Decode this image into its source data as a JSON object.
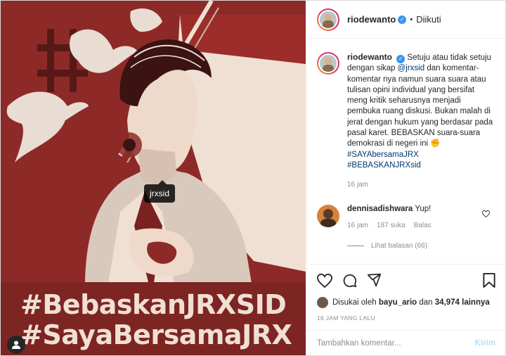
{
  "post": {
    "image_tag": "jrxsid",
    "poster_lines": [
      "#BebaskanJRXSID",
      "#SayaBersamaJRX"
    ]
  },
  "header": {
    "username": "riodewanto",
    "verified_mark": "✓",
    "separator": "•",
    "follow_state": "Diikuti"
  },
  "caption": {
    "username": "riodewanto",
    "text_1": "Setuju atau tidak setuju dengan sikap",
    "mention": "@jrxsid",
    "text_2": "dan komentar-komentar nya namun suara suara atau tulisan opini individual yang bersifat meng kritik seharusnya menjadi pembuka ruang diskusi. Bukan malah di jerat dengan hukum yang berdasar pada pasal karet. BEBASKAN suara-suara demokrasi di negeri ini",
    "emoji": "✊",
    "hashtag_1": "#SAYAbersamaJRX",
    "hashtag_2": "#BEBASKANJRXsid",
    "time": "16 jam"
  },
  "comment": {
    "username": "dennisadishwara",
    "text": "Yup!",
    "time": "16 jam",
    "likes": "187 suka",
    "reply_label": "Balas",
    "view_replies": "Lihat balasan (66)"
  },
  "likes": {
    "prefix": "Disukai oleh",
    "user": "bayu_ario",
    "conjunction": "dan",
    "count": "34,974 lainnya"
  },
  "post_time": "16 JAM YANG LALU",
  "add_comment": {
    "placeholder": "Tambahkan komentar...",
    "post_label": "Kirim"
  },
  "colors": {
    "poster_red": "#8d2a27",
    "poster_cream": "#f0e0d3",
    "link": "#00376b",
    "verified": "#3897f0"
  },
  "icons": [
    "heart-icon",
    "comment-icon",
    "share-icon",
    "bookmark-icon",
    "user-tag-icon"
  ]
}
